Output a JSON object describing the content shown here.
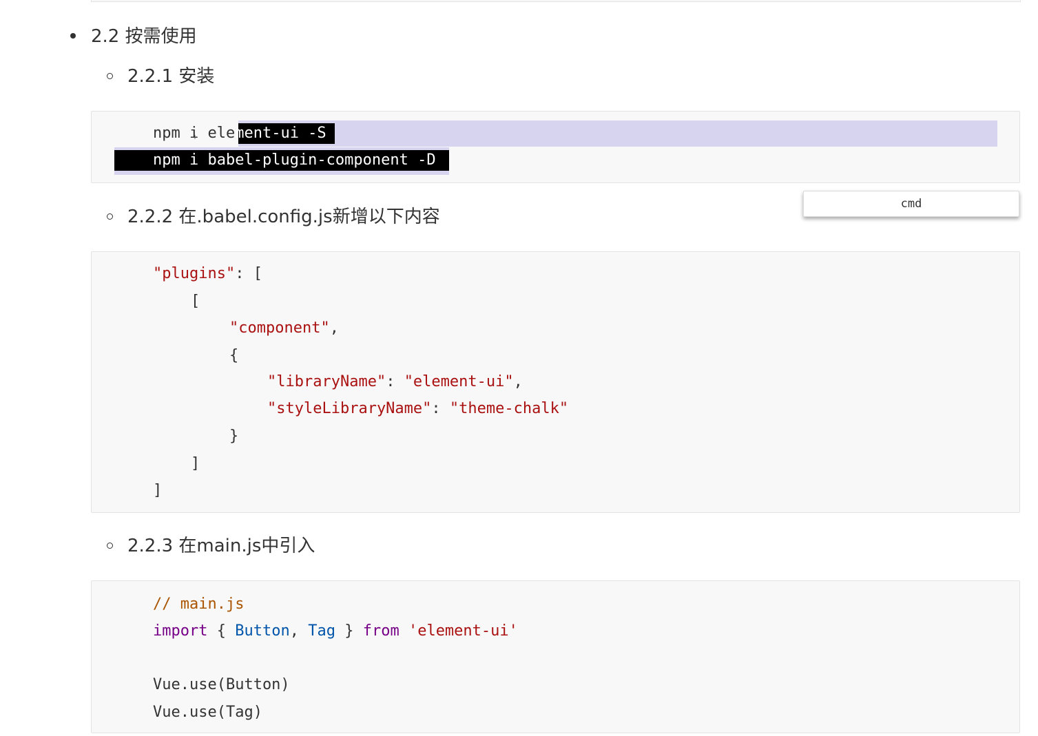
{
  "sections": {
    "s22": "2.2 按需使用",
    "s221": "2.2.1 安装",
    "s222": "2.2.2 在.babel.config.js新增以下内容",
    "s223": "2.2.3 在main.js中引入"
  },
  "install_block": {
    "line1_pre": "npm i ele",
    "line1_sel": "ment-ui -S",
    "line2": "npm i babel-plugin-component -D",
    "language": "cmd"
  },
  "babel_block": {
    "l1_key": "\"plugins\"",
    "l1_rest": ": [",
    "l2": "[",
    "l3_str": "\"component\"",
    "l3_rest": ",",
    "l4": "{",
    "l5_key": "\"libraryName\"",
    "l5_sep": ": ",
    "l5_val": "\"element-ui\"",
    "l5_rest": ",",
    "l6_key": "\"styleLibraryName\"",
    "l6_sep": ": ",
    "l6_val": "\"theme-chalk\"",
    "l7": "}",
    "l8": "]",
    "l9": "]"
  },
  "main_block": {
    "comment": "// main.js",
    "import_kw": "import",
    "brace_open": " { ",
    "button": "Button",
    "comma": ", ",
    "tag": "Tag",
    "brace_close": " } ",
    "from_kw": "from",
    "module": "'element-ui'",
    "use1": "Vue.use(Button)",
    "use2": "Vue.use(Tag)"
  },
  "colors": {
    "string": "#aa1111",
    "keyword": "#770088",
    "variable": "#0055aa",
    "comment": "#aa5500",
    "selection_light": "#d7d4f0",
    "selection_dark": "#000000"
  }
}
